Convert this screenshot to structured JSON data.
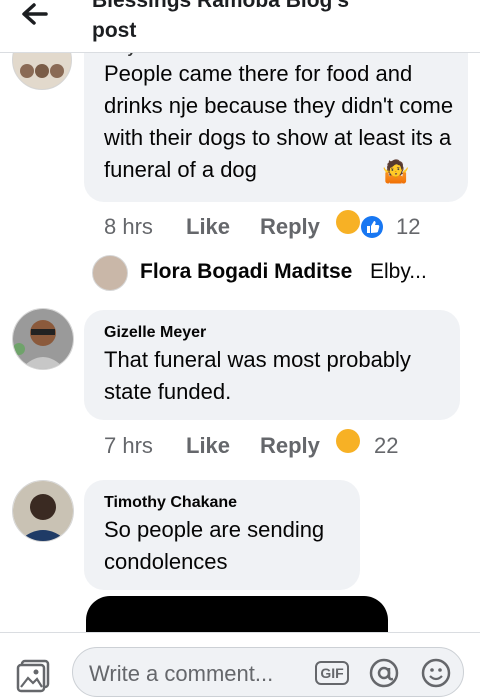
{
  "header": {
    "title": "Blessings Ramoba Blog's\npost"
  },
  "comments": [
    {
      "author": "Elby Bella Sithandwa Mekhtha",
      "text": "People came there for food and drinks nje because they didn't come with their dogs to show at least its a funeral of a dog",
      "time": "8 hrs",
      "like": "Like",
      "reply": "Reply",
      "reaction_count": "12"
    },
    {
      "author": "Gizelle Meyer",
      "text": "That funeral was most probably state funded.",
      "time": "7 hrs",
      "like": "Like",
      "reply": "Reply",
      "reaction_count": "22"
    },
    {
      "author": "Timothy Chakane",
      "text": "So people are sending condolences"
    }
  ],
  "reply_preview": {
    "name": "Flora Bogadi Maditse",
    "snippet": "Elby..."
  },
  "composer": {
    "placeholder": "Write a comment...",
    "gif_label": "GIF"
  },
  "colors": {
    "bubble": "#f0f2f5",
    "meta": "#65676b",
    "like_blue": "#1877f2"
  }
}
